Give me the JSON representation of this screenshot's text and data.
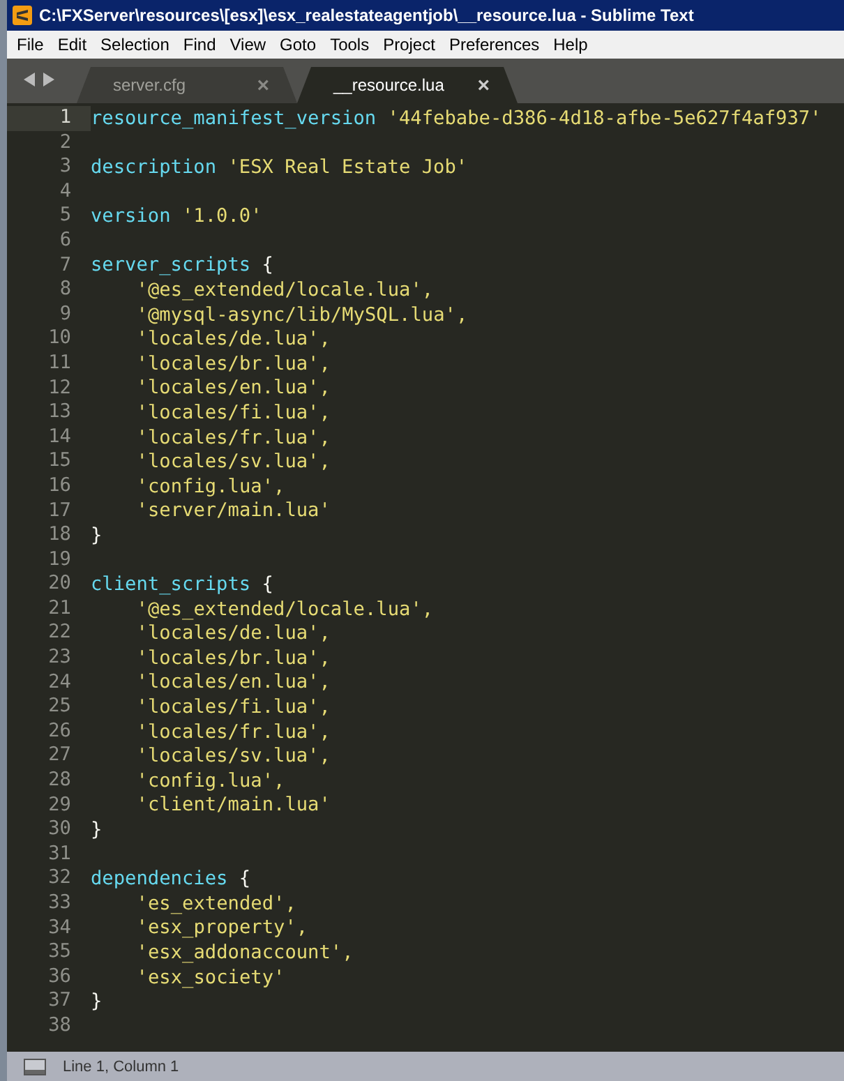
{
  "window": {
    "title": "C:\\FXServer\\resources\\[esx]\\esx_realestateagentjob\\__resource.lua - Sublime Text"
  },
  "menu": [
    "File",
    "Edit",
    "Selection",
    "Find",
    "View",
    "Goto",
    "Tools",
    "Project",
    "Preferences",
    "Help"
  ],
  "tabs": [
    {
      "label": "server.cfg",
      "selected": false,
      "close": "×"
    },
    {
      "label": "__resource.lua",
      "selected": true,
      "close": "×"
    }
  ],
  "editor": {
    "lines": [
      {
        "number": "1",
        "current": true,
        "tokens": [
          {
            "kind": "ident",
            "text": "resource_manifest_version"
          },
          {
            "kind": "string",
            "text": "'44febabe-d386-4d18-afbe-5e627f4af937'"
          }
        ]
      },
      {
        "number": "2",
        "current": false
      },
      {
        "number": "3",
        "current": false,
        "tokens": [
          {
            "kind": "ident",
            "text": "description"
          },
          {
            "kind": "string",
            "text": "'ESX Real Estate Job'"
          }
        ]
      },
      {
        "number": "4",
        "current": false
      },
      {
        "number": "5",
        "current": false,
        "tokens": [
          {
            "kind": "ident",
            "text": "version"
          },
          {
            "kind": "string",
            "text": "'1.0.0'"
          }
        ]
      },
      {
        "number": "6",
        "current": false
      },
      {
        "number": "7",
        "current": false,
        "tokens": [
          {
            "kind": "ident",
            "text": "server_scripts"
          },
          {
            "kind": "punct",
            "text": "{"
          }
        ],
        "children": [
          {
            "number": "8",
            "current": false,
            "tokens": [
              {
                "kind": "string",
                "text": "'@es_extended/locale.lua',"
              }
            ]
          },
          {
            "number": "9",
            "current": false,
            "tokens": [
              {
                "kind": "string",
                "text": "'@mysql-async/lib/MySQL.lua',"
              }
            ]
          },
          {
            "number": "10",
            "current": false,
            "tokens": [
              {
                "kind": "string",
                "text": "'locales/de.lua',"
              }
            ]
          },
          {
            "number": "11",
            "current": false,
            "tokens": [
              {
                "kind": "string",
                "text": "'locales/br.lua',"
              }
            ]
          },
          {
            "number": "12",
            "current": false,
            "tokens": [
              {
                "kind": "string",
                "text": "'locales/en.lua',"
              }
            ]
          },
          {
            "number": "13",
            "current": false,
            "tokens": [
              {
                "kind": "string",
                "text": "'locales/fi.lua',"
              }
            ]
          },
          {
            "number": "14",
            "current": false,
            "tokens": [
              {
                "kind": "string",
                "text": "'locales/fr.lua',"
              }
            ]
          },
          {
            "number": "15",
            "current": false,
            "tokens": [
              {
                "kind": "string",
                "text": "'locales/sv.lua',"
              }
            ]
          },
          {
            "number": "16",
            "current": false,
            "tokens": [
              {
                "kind": "string",
                "text": "'config.lua',"
              }
            ]
          },
          {
            "number": "17",
            "current": false,
            "tokens": [
              {
                "kind": "string",
                "text": "'server/main.lua'"
              }
            ]
          }
        ]
      },
      {
        "number": "18",
        "current": false,
        "tokens": [
          {
            "kind": "punct",
            "text": "}"
          }
        ]
      },
      {
        "number": "19",
        "current": false
      },
      {
        "number": "20",
        "current": false,
        "tokens": [
          {
            "kind": "ident",
            "text": "client_scripts"
          },
          {
            "kind": "punct",
            "text": "{"
          }
        ],
        "children": [
          {
            "number": "21",
            "current": false,
            "tokens": [
              {
                "kind": "string",
                "text": "'@es_extended/locale.lua',"
              }
            ]
          },
          {
            "number": "22",
            "current": false,
            "tokens": [
              {
                "kind": "string",
                "text": "'locales/de.lua',"
              }
            ]
          },
          {
            "number": "23",
            "current": false,
            "tokens": [
              {
                "kind": "string",
                "text": "'locales/br.lua',"
              }
            ]
          },
          {
            "number": "24",
            "current": false,
            "tokens": [
              {
                "kind": "string",
                "text": "'locales/en.lua',"
              }
            ]
          },
          {
            "number": "25",
            "current": false,
            "tokens": [
              {
                "kind": "string",
                "text": "'locales/fi.lua',"
              }
            ]
          },
          {
            "number": "26",
            "current": false,
            "tokens": [
              {
                "kind": "string",
                "text": "'locales/fr.lua',"
              }
            ]
          },
          {
            "number": "27",
            "current": false,
            "tokens": [
              {
                "kind": "string",
                "text": "'locales/sv.lua',"
              }
            ]
          },
          {
            "number": "28",
            "current": false,
            "tokens": [
              {
                "kind": "string",
                "text": "'config.lua',"
              }
            ]
          },
          {
            "number": "29",
            "current": false,
            "tokens": [
              {
                "kind": "string",
                "text": "'client/main.lua'"
              }
            ]
          }
        ]
      },
      {
        "number": "30",
        "current": false,
        "tokens": [
          {
            "kind": "punct",
            "text": "}"
          }
        ]
      },
      {
        "number": "31",
        "current": false
      },
      {
        "number": "32",
        "current": false,
        "tokens": [
          {
            "kind": "ident",
            "text": "dependencies"
          },
          {
            "kind": "punct",
            "text": "{"
          }
        ],
        "children": [
          {
            "number": "33",
            "current": false,
            "tokens": [
              {
                "kind": "string",
                "text": "'es_extended',"
              }
            ]
          },
          {
            "number": "34",
            "current": false,
            "tokens": [
              {
                "kind": "string",
                "text": "'esx_property',"
              }
            ]
          },
          {
            "number": "35",
            "current": false,
            "tokens": [
              {
                "kind": "string",
                "text": "'esx_addonaccount',"
              }
            ]
          },
          {
            "number": "36",
            "current": false,
            "tokens": [
              {
                "kind": "string",
                "text": "'esx_society'"
              }
            ]
          }
        ]
      },
      {
        "number": "37",
        "current": false,
        "tokens": [
          {
            "kind": "punct",
            "text": "}"
          }
        ]
      },
      {
        "number": "38",
        "current": false
      }
    ]
  },
  "status_bar": {
    "text": "Line 1, Column 1"
  }
}
